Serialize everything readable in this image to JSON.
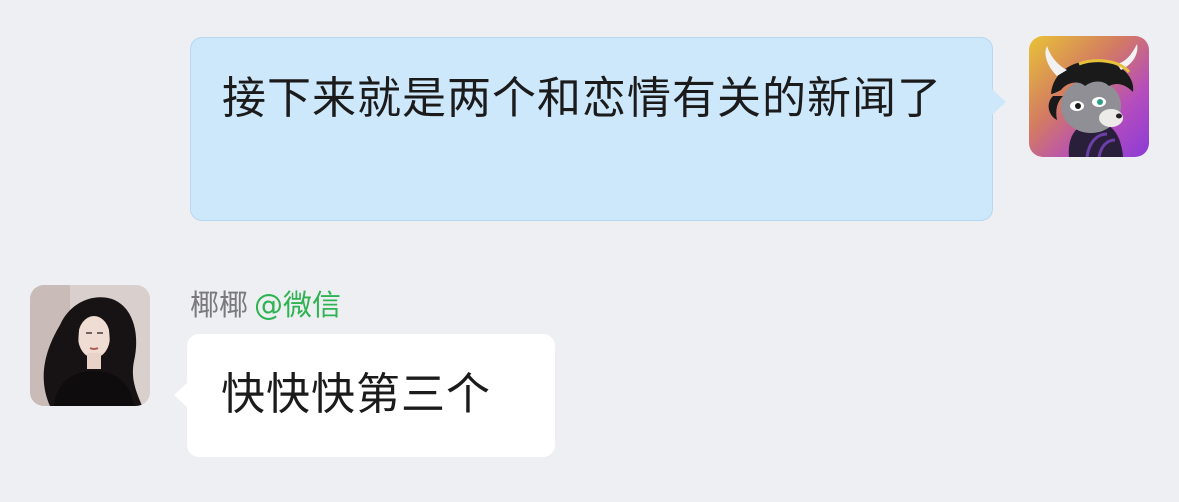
{
  "chat": {
    "outgoing": {
      "text": "接下来就是两个和恋情有关的新闻了",
      "bubble_color": "#cde7fb"
    },
    "incoming": {
      "sender_name": "椰椰",
      "sender_source": "@微信",
      "text": "快快快第三个",
      "bubble_color": "#ffffff"
    },
    "colors": {
      "background": "#eeeff3",
      "source_green": "#2fb352"
    }
  }
}
